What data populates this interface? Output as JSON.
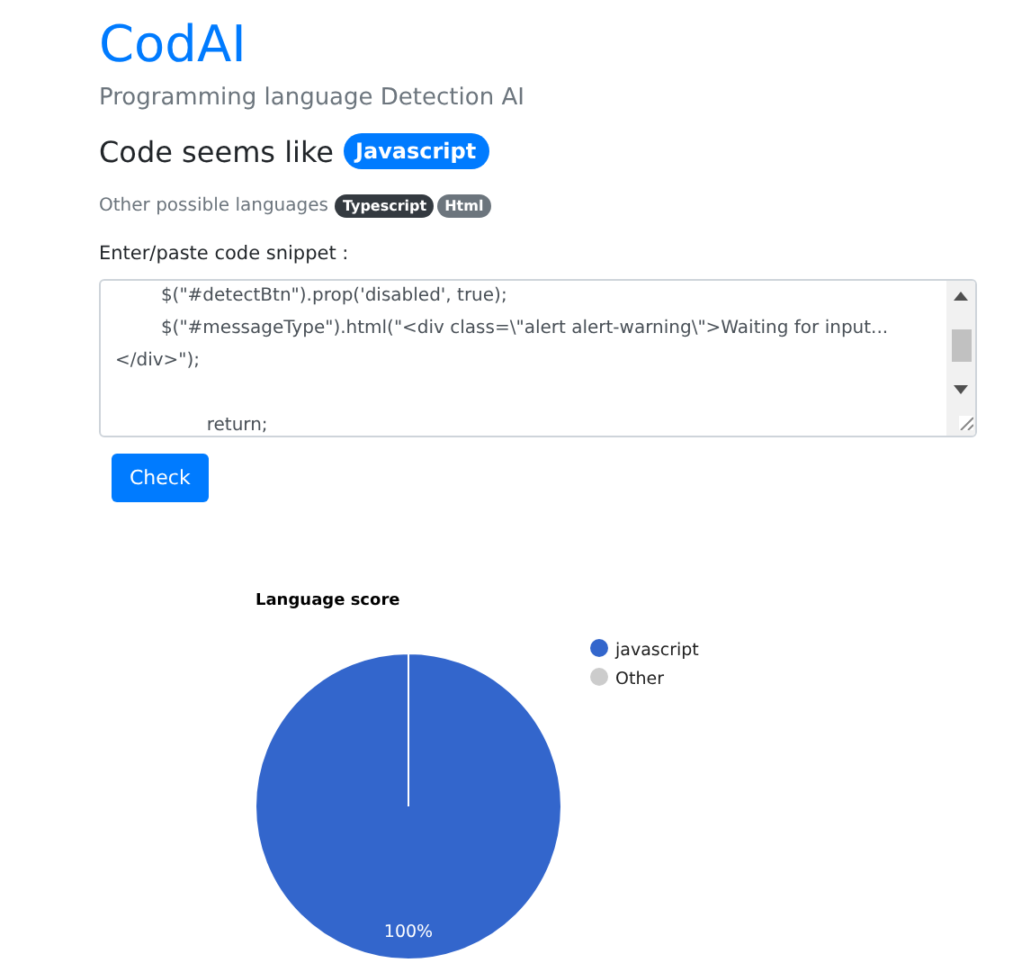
{
  "header": {
    "title": "CodAI",
    "subtitle": "Programming language Detection AI"
  },
  "result": {
    "label": "Code seems like",
    "language": "Javascript"
  },
  "others": {
    "label": "Other possible languages",
    "languages": [
      {
        "name": "Typescript",
        "color": "#343a40"
      },
      {
        "name": "Html",
        "color": "#6c757d"
      }
    ]
  },
  "snippet": {
    "label": "Enter/paste code snippet :",
    "value": "        $(\"#detectBtn\").prop('disabled', true);\n        $(\"#messageType\").html(\"<div class=\\\"alert alert-warning\\\">Waiting for input...</div>\");\n\n                return;"
  },
  "check_button": "Check",
  "chart_data": {
    "type": "pie",
    "title": "Language score",
    "categories": [
      "javascript",
      "Other"
    ],
    "values": [
      100,
      0
    ],
    "colors": [
      "#3366cc",
      "#cccccc"
    ],
    "value_labels": [
      "100%",
      null
    ]
  }
}
